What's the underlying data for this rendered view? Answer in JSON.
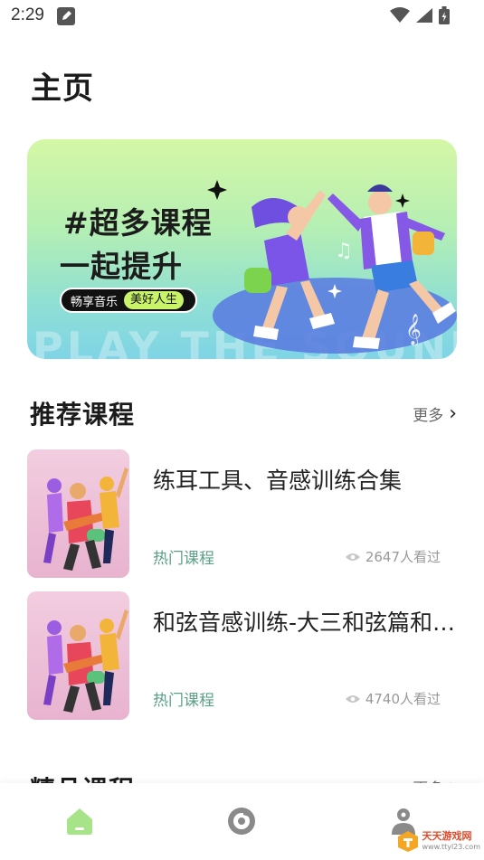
{
  "status_bar": {
    "time": "2:29"
  },
  "page": {
    "title": "主页"
  },
  "banner": {
    "line1": "#超多课程",
    "line2": "一起提升",
    "pill_text": "畅享音乐",
    "pill_highlight": "美好人生",
    "watermark": "PLAY THE SOUNDS"
  },
  "recommended": {
    "title": "推荐课程",
    "more_label": "更多",
    "items": [
      {
        "title": "练耳工具、音感训练合集",
        "tag": "热门课程",
        "views": "2647人看过"
      },
      {
        "title": "和弦音感训练-大三和弦篇和弦音感训练",
        "tag": "热门课程",
        "views": "4740人看过"
      }
    ]
  },
  "featured": {
    "title": "精品课程",
    "more_label": "更多"
  },
  "tab_bar": {
    "items": [
      "home",
      "music",
      "profile"
    ],
    "active": "home"
  },
  "corner_badge": {
    "name": "天天游戏网",
    "url": "www.ttyl23.com"
  },
  "colors": {
    "accent_green": "#5aa086",
    "tab_active": "#a6e389",
    "banner_start": "#d5f7a6",
    "banner_end": "#7fd4e6"
  }
}
